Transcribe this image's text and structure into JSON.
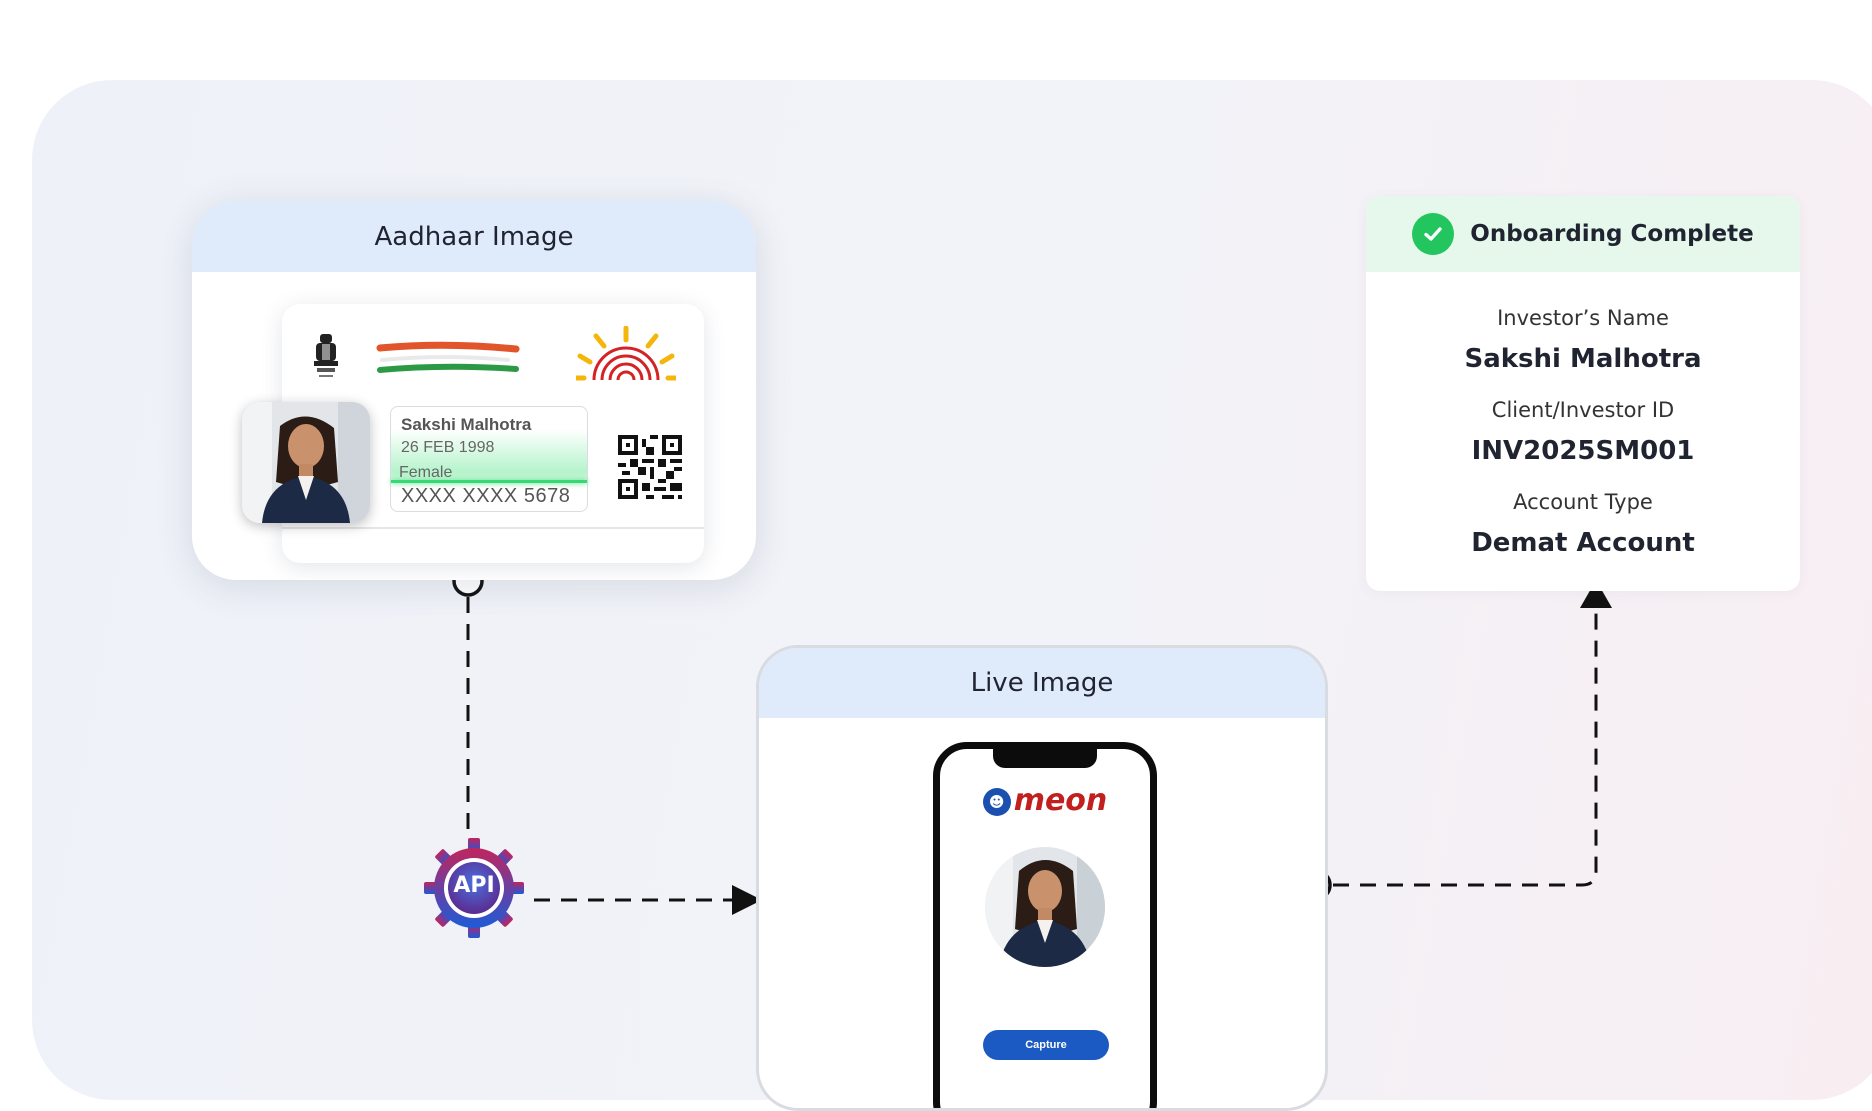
{
  "aadhaar": {
    "title": "Aadhaar Image",
    "name": "Sakshi Malhotra",
    "dob": "26 FEB 1998",
    "gender": "Female",
    "number": "XXXX XXXX 5678"
  },
  "api": {
    "label": "API"
  },
  "live": {
    "title": "Live Image",
    "brand": "meon",
    "capture_label": "Capture"
  },
  "onboarding": {
    "title": "Onboarding Complete",
    "fields": [
      {
        "label": "Investor’s Name",
        "value": "Sakshi Malhotra"
      },
      {
        "label": "Client/Investor ID",
        "value": "INV2025SM001"
      },
      {
        "label": "Account Type",
        "value": "Demat Account"
      }
    ]
  },
  "colors": {
    "header_blue": "#dfeafb",
    "header_green": "#e6f8ec",
    "check_green": "#22c55e",
    "capture_blue": "#1b5ac2",
    "scan_green": "#36d873"
  }
}
